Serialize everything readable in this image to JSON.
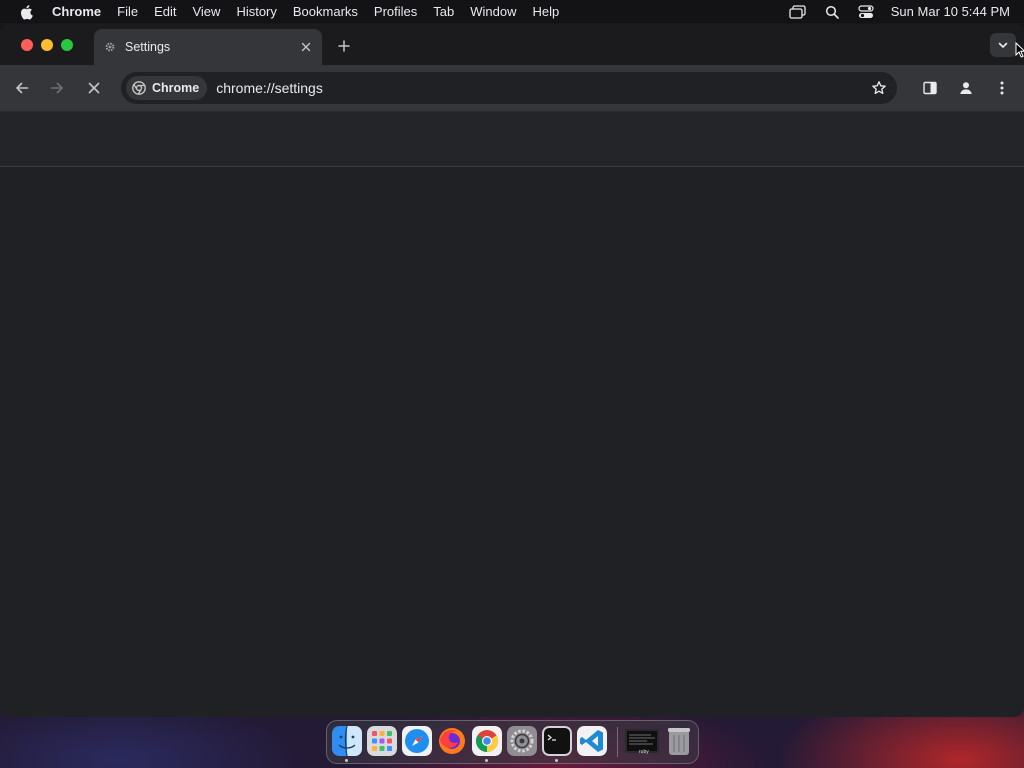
{
  "menubar": {
    "app_name": "Chrome",
    "items": [
      "File",
      "Edit",
      "View",
      "History",
      "Bookmarks",
      "Profiles",
      "Tab",
      "Window",
      "Help"
    ],
    "clock": "Sun Mar 10  5:44 PM"
  },
  "tab": {
    "title": "Settings",
    "icon": "gear-icon"
  },
  "omnibox": {
    "chip_label": "Chrome",
    "url": "chrome://settings"
  },
  "dock": {
    "apps": [
      "Finder",
      "Launchpad",
      "Safari",
      "Firefox",
      "Chrome",
      "System Settings",
      "Terminal",
      "Visual Studio Code"
    ],
    "minimized_label": "ruby",
    "trash": "Trash"
  },
  "colors": {
    "window_bg": "#202124",
    "toolbar_bg": "#35363a",
    "tabstrip_bg": "#1b1b1d",
    "menubar_bg": "#131316"
  }
}
